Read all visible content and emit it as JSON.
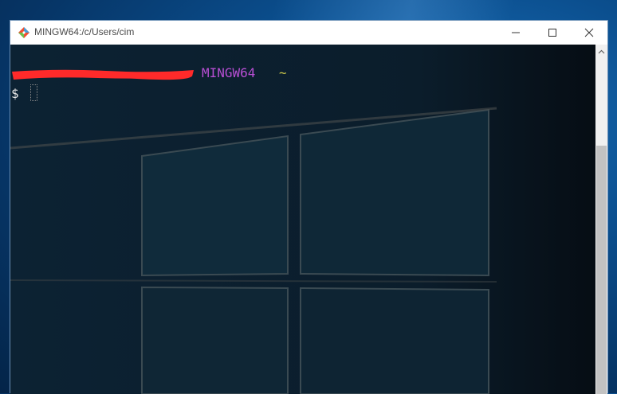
{
  "window": {
    "title": "MINGW64:/c/Users/cim"
  },
  "terminal": {
    "host_label": "MINGW64",
    "path": "~",
    "prompt_symbol": "$"
  },
  "icons": {
    "app": "git-bash-icon",
    "minimize": "minimize-icon",
    "maximize": "maximize-icon",
    "close": "close-icon",
    "scroll_up": "chevron-up-icon"
  },
  "colors": {
    "host": "#b84fd4",
    "path": "#c7c44a",
    "redaction": "#ff2a2a",
    "terminal_bg": "#0b1a26"
  }
}
